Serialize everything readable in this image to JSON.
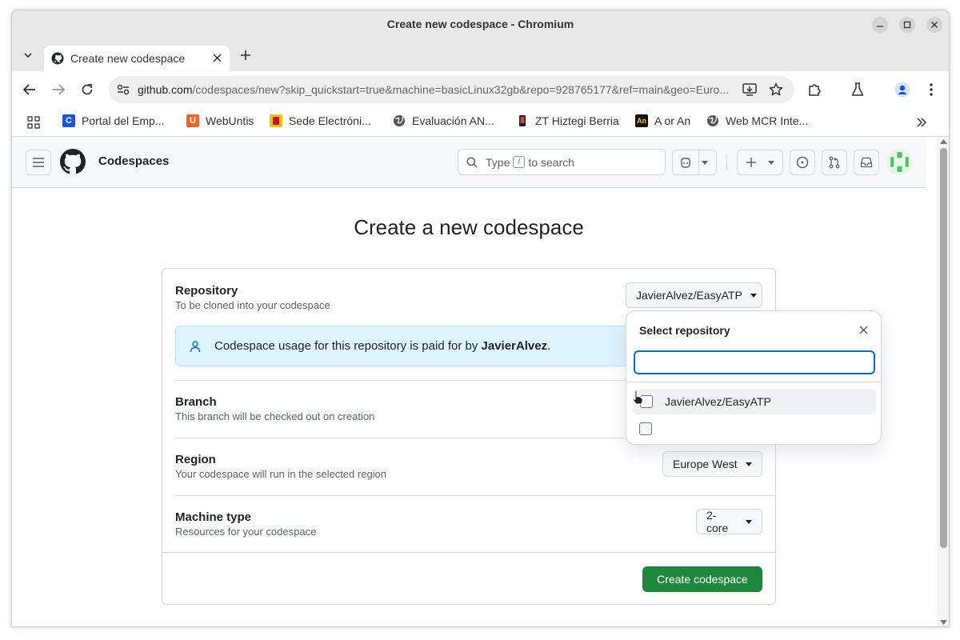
{
  "window": {
    "title": "Create new codespace - Chromium"
  },
  "tab": {
    "title": "Create new codespace"
  },
  "omnibox": {
    "host": "github.com",
    "path": "/codespaces/new?skip_quickstart=true&machine=basicLinux32gb&repo=928765177&ref=main&geo=Euro..."
  },
  "bookmarks": [
    {
      "label": "Portal del Emp...",
      "icon": "C",
      "color": "#1a56db"
    },
    {
      "label": "WebUntis",
      "icon": "U",
      "color": "#f26522"
    },
    {
      "label": "Sede Electróni...",
      "icon": "es",
      "color": "#c8102e"
    },
    {
      "label": "Evaluación AN...",
      "icon": "globe",
      "color": "#444444"
    },
    {
      "label": "ZT Hiztegi Berria",
      "icon": "phone",
      "color": "#222222"
    },
    {
      "label": "A or An",
      "icon": "An",
      "color": "#111111"
    },
    {
      "label": "Web MCR Inte...",
      "icon": "globe",
      "color": "#444444"
    }
  ],
  "github": {
    "context": "Codespaces",
    "search_type": "Type",
    "search_key": "/",
    "search_rest": "to search"
  },
  "page": {
    "heading": "Create a new codespace",
    "repository": {
      "label": "Repository",
      "sub": "To be cloned into your codespace",
      "value": "JavierAlvez/EasyATP"
    },
    "notice": {
      "text_before": "Codespace usage for this repository is paid for by ",
      "owner": "JavierAlvez",
      "text_after": "."
    },
    "branch": {
      "label": "Branch",
      "sub": "This branch will be checked out on creation"
    },
    "region": {
      "label": "Region",
      "sub": "Your codespace will run in the selected region",
      "value": "Europe West"
    },
    "machine": {
      "label": "Machine type",
      "sub": "Resources for your codespace",
      "value": "2-core"
    },
    "create_label": "Create codespace"
  },
  "popover": {
    "title": "Select repository",
    "search_value": "",
    "items": [
      "JavierAlvez/EasyATP",
      ""
    ]
  },
  "colors": {
    "primary_button": "#1f883d",
    "focus_ring": "#0969da",
    "notice_bg": "#ddf4ff"
  }
}
